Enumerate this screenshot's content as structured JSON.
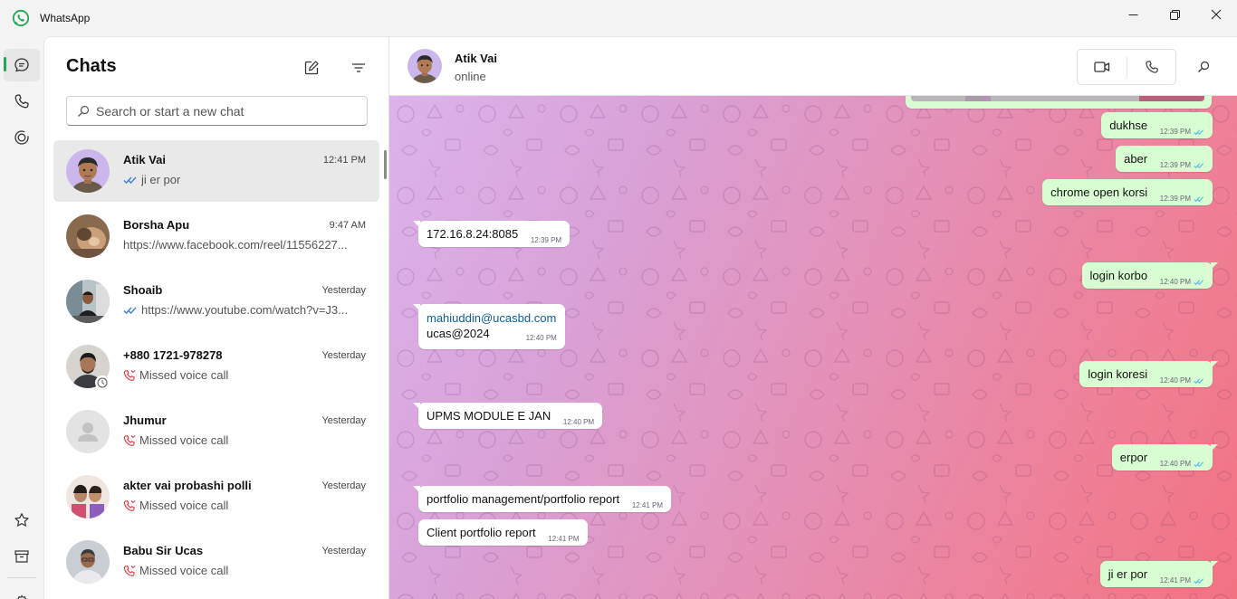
{
  "window": {
    "title": "WhatsApp",
    "controls": [
      "minimize",
      "maximize",
      "close"
    ]
  },
  "rail": {
    "top_items": [
      {
        "name": "chats",
        "icon": "chat-icon",
        "active": true
      },
      {
        "name": "calls",
        "icon": "phone-icon"
      },
      {
        "name": "status",
        "icon": "status-icon"
      }
    ],
    "bottom_items": [
      {
        "name": "starred",
        "icon": "star-icon"
      },
      {
        "name": "archived",
        "icon": "archive-icon"
      },
      {
        "name": "settings",
        "icon": "gear-icon"
      }
    ]
  },
  "chat_list": {
    "title": "Chats",
    "new_chat_icon": "new-chat-icon",
    "filter_icon": "filter-icon",
    "search_placeholder": "Search or start a new chat",
    "search_value": "",
    "items": [
      {
        "name": "Atik Vai",
        "time": "12:41 PM",
        "preview": "ji er por",
        "read_ticks": true,
        "selected": true
      },
      {
        "name": "Borsha Apu",
        "time": "9:47 AM",
        "preview": "https://www.facebook.com/reel/11556227..."
      },
      {
        "name": "Shoaib",
        "time": "Yesterday",
        "preview": "https://www.youtube.com/watch?v=J3...",
        "read_ticks": true
      },
      {
        "name": "+880 1721-978278",
        "time": "Yesterday",
        "preview": "Missed voice call",
        "missed_call": true,
        "status_badge": true
      },
      {
        "name": "Jhumur",
        "time": "Yesterday",
        "preview": "Missed voice call",
        "missed_call": true,
        "default_avatar": true
      },
      {
        "name": "akter vai probashi polli",
        "time": "Yesterday",
        "preview": "Missed voice call",
        "missed_call": true
      },
      {
        "name": "Babu Sir Ucas",
        "time": "Yesterday",
        "preview": "Missed voice call",
        "missed_call": true
      }
    ]
  },
  "conversation": {
    "contact_name": "Atik Vai",
    "contact_status": "online",
    "actions": [
      "video-call-icon",
      "voice-call-icon",
      "search-icon"
    ],
    "messages": [
      {
        "dir": "out",
        "text": "dukhse",
        "time": "12:39 PM",
        "read": true
      },
      {
        "dir": "out",
        "text": "aber",
        "time": "12:39 PM",
        "read": true
      },
      {
        "dir": "out",
        "text": "chrome open korsi",
        "time": "12:39 PM",
        "read": true
      },
      {
        "dir": "in",
        "text": "172.16.8.24:8085",
        "time": "12:39 PM"
      },
      {
        "dir": "out",
        "text": "login korbo",
        "time": "12:40 PM",
        "read": true
      },
      {
        "dir": "in",
        "text": "mahiuddin@ucasbd.com",
        "text2": "ucas@2024",
        "time": "12:40 PM"
      },
      {
        "dir": "out",
        "text": "login koresi",
        "time": "12:40 PM",
        "read": true
      },
      {
        "dir": "in",
        "text": "UPMS MODULE E JAN",
        "time": "12:40 PM"
      },
      {
        "dir": "out",
        "text": "erpor",
        "time": "12:40 PM",
        "read": true
      },
      {
        "dir": "in",
        "text": "portfolio management/portfolio report",
        "time": "12:41 PM"
      },
      {
        "dir": "in",
        "text": "Client portfolio report",
        "time": "12:41 PM"
      },
      {
        "dir": "out",
        "text": "ji er por",
        "time": "12:41 PM",
        "read": true
      }
    ]
  },
  "colors": {
    "accent": "#1fa855",
    "outgoing_bubble": "#d9fdd3",
    "incoming_bubble": "#ffffff",
    "read_tick": "#53bdeb",
    "missed_call": "#e5353b",
    "link": "#0b5fa0"
  }
}
